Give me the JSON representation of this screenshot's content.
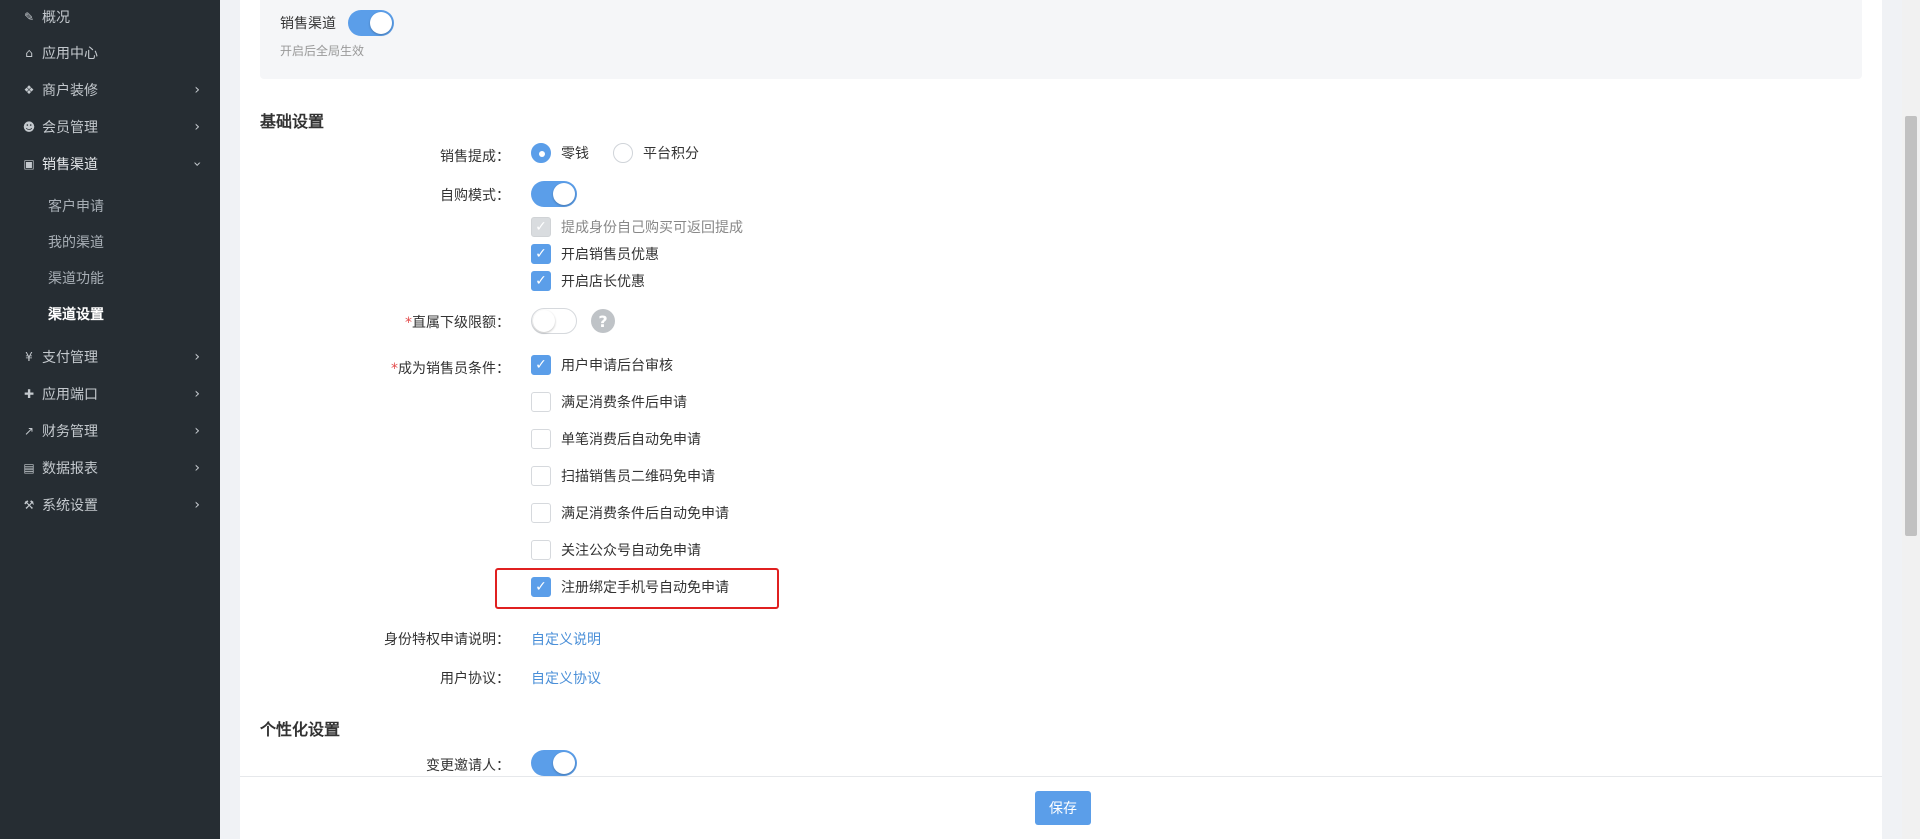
{
  "sidebar": {
    "items": [
      {
        "label": "概况",
        "icon": "edit-icon"
      },
      {
        "label": "应用中心",
        "icon": "home-icon"
      },
      {
        "label": "商户装修",
        "icon": "cubes-icon"
      },
      {
        "label": "会员管理",
        "icon": "users-icon"
      },
      {
        "label": "销售渠道",
        "icon": "money-icon"
      },
      {
        "label": "支付管理",
        "icon": "yen-icon"
      },
      {
        "label": "应用端口",
        "icon": "puzzle-icon"
      },
      {
        "label": "财务管理",
        "icon": "line-chart-icon"
      },
      {
        "label": "数据报表",
        "icon": "table-icon"
      },
      {
        "label": "系统设置",
        "icon": "gavel-icon"
      }
    ],
    "sub_items": [
      "客户申请",
      "我的渠道",
      "渠道功能",
      "渠道设置"
    ],
    "active_sub": "渠道设置"
  },
  "top_card": {
    "label": "销售渠道",
    "hint": "开启后全局生效",
    "enabled": true
  },
  "basic": {
    "title": "基础设置",
    "commission_label": "销售提成：",
    "commission_options": [
      "零钱",
      "平台积分"
    ],
    "commission_selected": "零钱",
    "self_buy_label": "自购模式：",
    "self_buy_enabled": true,
    "self_buy_options": [
      {
        "label": "提成身份自己购买可返回提成",
        "checked": true,
        "disabled": true
      },
      {
        "label": "开启销售员优惠",
        "checked": true,
        "disabled": false
      },
      {
        "label": "开启店长优惠",
        "checked": true,
        "disabled": false
      }
    ],
    "limit_label": "直属下级限额：",
    "limit_required": "*",
    "limit_enabled": false,
    "help_text": "?",
    "condition_label": "成为销售员条件：",
    "condition_required": "*",
    "conditions": [
      {
        "label": "用户申请后台审核",
        "checked": true
      },
      {
        "label": "满足消费条件后申请",
        "checked": false
      },
      {
        "label": "单笔消费后自动免申请",
        "checked": false
      },
      {
        "label": "扫描销售员二维码免申请",
        "checked": false
      },
      {
        "label": "满足消费条件后自动免申请",
        "checked": false
      },
      {
        "label": "关注公众号自动免申请",
        "checked": false
      },
      {
        "label": "注册绑定手机号自动免申请",
        "checked": true
      }
    ],
    "privilege_label": "身份特权申请说明：",
    "privilege_link": "自定义说明",
    "agreement_label": "用户协议：",
    "agreement_link": "自定义协议"
  },
  "personal": {
    "title": "个性化设置",
    "inviter_label": "变更邀请人：",
    "inviter_enabled": true
  },
  "footer": {
    "save_label": "保存"
  },
  "colors": {
    "sidebar_bg": "#262d33",
    "accent": "#5b9ee9",
    "highlight": "#e02020"
  }
}
